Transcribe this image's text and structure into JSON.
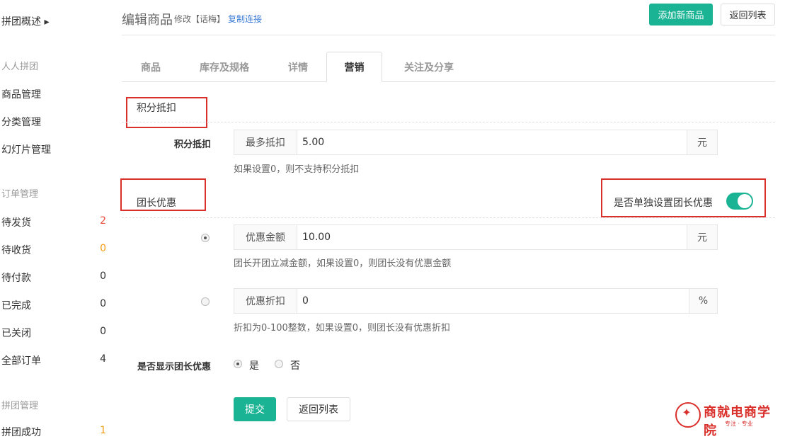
{
  "sidebar": {
    "title": "拼团概述",
    "groups": [
      {
        "title": "人人拼团",
        "items": [
          {
            "label": "商品管理"
          },
          {
            "label": "分类管理"
          },
          {
            "label": "幻灯片管理"
          }
        ]
      },
      {
        "title": "订单管理",
        "items": [
          {
            "label": "待发货",
            "count": "2"
          },
          {
            "label": "待收货",
            "count": "0"
          },
          {
            "label": "待付款",
            "count": "0"
          },
          {
            "label": "已完成",
            "count": "0"
          },
          {
            "label": "已关闭",
            "count": "0"
          },
          {
            "label": "全部订单",
            "count": "4"
          }
        ]
      },
      {
        "title": "拼团管理",
        "items": [
          {
            "label": "拼团成功",
            "count": "1"
          }
        ]
      }
    ]
  },
  "header": {
    "title": "编辑商品",
    "edit_note": "修改【话梅】",
    "copy_link": "复制连接",
    "add_button": "添加新商品",
    "back_button": "返回列表"
  },
  "tabs": [
    {
      "label": "商品"
    },
    {
      "label": "库存及规格"
    },
    {
      "label": "详情"
    },
    {
      "label": "营销",
      "active": true
    },
    {
      "label": "关注及分享"
    }
  ],
  "points": {
    "section_title": "积分抵扣",
    "field_label": "积分抵扣",
    "addon": "最多抵扣",
    "value": "5.00",
    "unit": "元",
    "help": "如果设置0，则不支持积分抵扣"
  },
  "leader": {
    "section_title": "团长优惠",
    "toggle_label": "是否单独设置团长优惠",
    "toggle_on": true,
    "amount": {
      "addon": "优惠金额",
      "value": "10.00",
      "unit": "元",
      "help": "团长开团立减金额，如果设置0，则团长没有优惠金额",
      "selected": true
    },
    "discount": {
      "addon": "优惠折扣",
      "value": "0",
      "unit": "%",
      "help": "折扣为0-100整数，如果设置0，则团长没有优惠折扣",
      "selected": false
    },
    "show_label": "是否显示团长优惠",
    "show_yes": "是",
    "show_no": "否"
  },
  "actions": {
    "submit": "提交",
    "back": "返回列表"
  },
  "logo": {
    "name": "商就电商学院",
    "tagline": "专注 · 专业"
  },
  "colors": {
    "accent": "#1ab394",
    "highlight": "#d9302c",
    "link": "#3a7bd5"
  }
}
